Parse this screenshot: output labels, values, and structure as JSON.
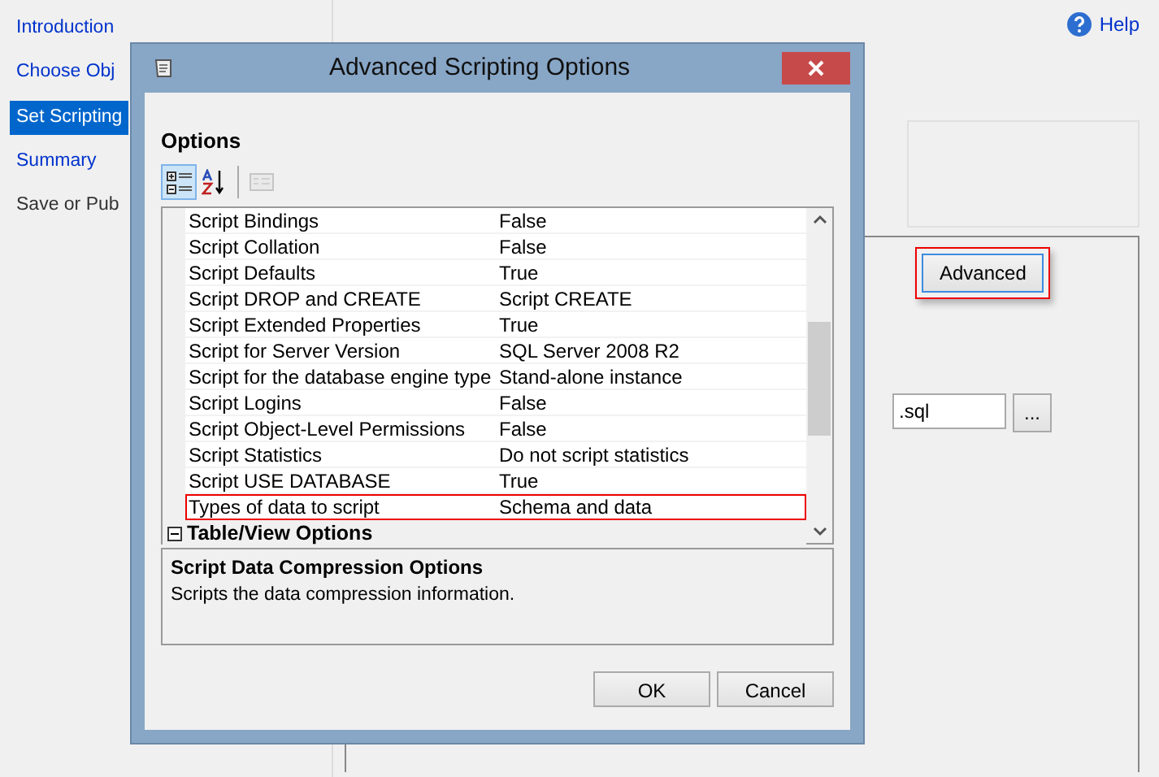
{
  "background": {
    "sidebar": [
      {
        "label": "Introduction",
        "selected": false
      },
      {
        "label": "Choose Obj",
        "selected": false
      },
      {
        "label": "Set Scripting",
        "selected": true
      },
      {
        "label": "Summary",
        "selected": false
      },
      {
        "label": "Save or Pub",
        "selected": false
      }
    ],
    "help": "Help",
    "advanced_button": {
      "label": "Advanced",
      "highlighted": true
    },
    "file_field": {
      "value": ".sql"
    },
    "browse_button": "..."
  },
  "dialog": {
    "title": "Advanced Scripting Options",
    "section": "Options",
    "toolbar": [
      {
        "kind": "categorized",
        "selected": true,
        "disabled": false
      },
      {
        "kind": "alphabetical",
        "selected": false,
        "disabled": false
      },
      {
        "kind": "property-pages",
        "selected": false,
        "disabled": true
      }
    ],
    "properties": [
      {
        "name": "Script Bindings",
        "value": "False",
        "highlighted": false
      },
      {
        "name": "Script Collation",
        "value": "False",
        "highlighted": false
      },
      {
        "name": "Script Defaults",
        "value": "True",
        "highlighted": false
      },
      {
        "name": "Script DROP and CREATE",
        "value": "Script CREATE",
        "highlighted": false
      },
      {
        "name": "Script Extended Properties",
        "value": "True",
        "highlighted": false
      },
      {
        "name": "Script for Server Version",
        "value": "SQL Server 2008 R2",
        "highlighted": false
      },
      {
        "name": "Script for the database engine type",
        "value": "Stand-alone instance",
        "highlighted": false
      },
      {
        "name": "Script Logins",
        "value": "False",
        "highlighted": false
      },
      {
        "name": "Script Object-Level Permissions",
        "value": "False",
        "highlighted": false
      },
      {
        "name": "Script Statistics",
        "value": "Do not script statistics",
        "highlighted": false
      },
      {
        "name": "Script USE DATABASE",
        "value": "True",
        "highlighted": false
      },
      {
        "name": "Types of data to script",
        "value": "Schema and data",
        "highlighted": true
      }
    ],
    "category": {
      "label": "Table/View Options",
      "expanded": true
    },
    "description": {
      "title": "Script Data Compression Options",
      "text": "Scripts the data compression information."
    },
    "buttons": [
      {
        "label": "OK"
      },
      {
        "label": "Cancel"
      }
    ]
  }
}
